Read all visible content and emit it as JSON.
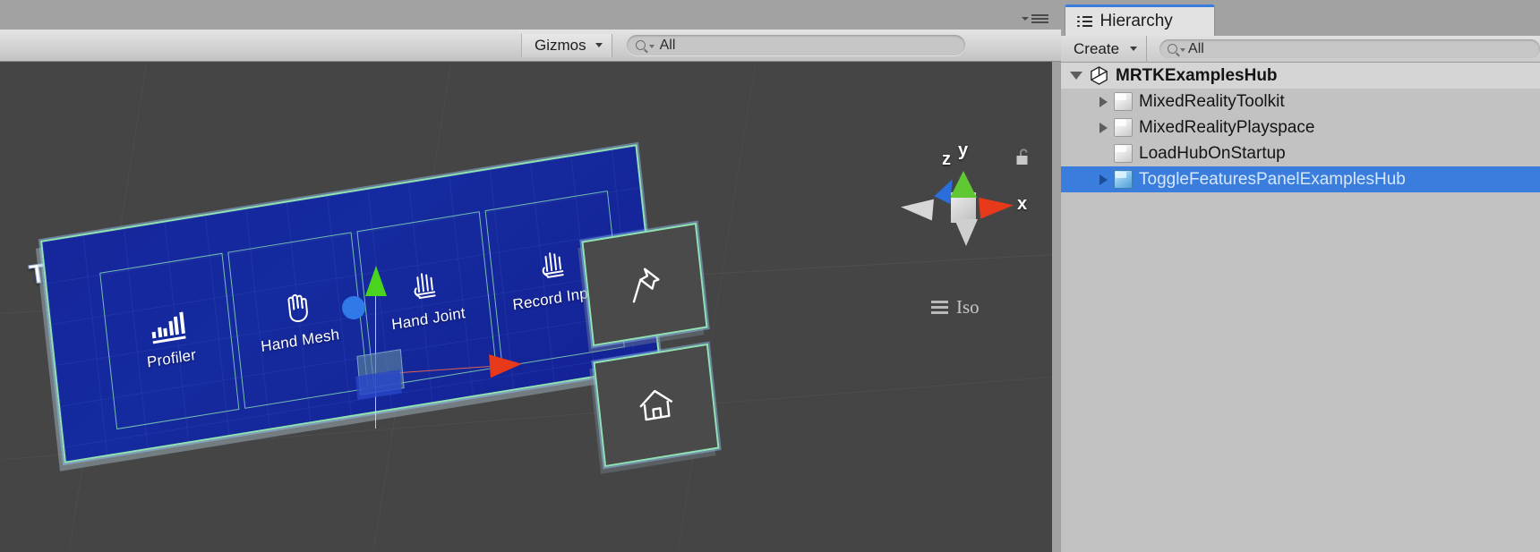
{
  "scene_toolbar": {
    "gizmos_label": "Gizmos",
    "search_placeholder": "All",
    "search_value": "",
    "search_icon": "magnifier-icon",
    "dropdown_icon": "chevron-down-icon"
  },
  "scene_view": {
    "axis_gizmo": {
      "labels": {
        "x": "x",
        "y": "y",
        "z": "z"
      },
      "colors": {
        "x": "#e8391b",
        "y": "#5fc832",
        "z": "#2a6ddb",
        "neutral": "#d7d7d7"
      }
    },
    "projection_label": "Iso",
    "projection_icon": "hamburger-icon",
    "lock_icon": "unlocked-padlock-icon",
    "background_color": "#454545"
  },
  "mrtk_panel": {
    "title": "Toggle Features",
    "panel_color": "#162a9e",
    "selection_outline_color": "#8fe3b4",
    "buttons": [
      {
        "label": "Profiler",
        "icon": "bar-chart-icon"
      },
      {
        "label": "Hand Mesh",
        "icon": "hand-icon"
      },
      {
        "label": "Hand Joint",
        "icon": "hand-joints-icon"
      },
      {
        "label": "Record Input",
        "icon": "hand-joints-icon"
      }
    ],
    "side_buttons": [
      {
        "label": "",
        "icon": "pin-icon"
      },
      {
        "label": "",
        "icon": "home-icon"
      }
    ]
  },
  "hierarchy": {
    "tab_label": "Hierarchy",
    "tab_icon": "list-icon",
    "create_label": "Create",
    "create_icon": "chevron-down-icon",
    "search_placeholder": "All",
    "search_value": "",
    "selection_color": "#3b7ddd",
    "rows": [
      {
        "label": "MRTKExamplesHub",
        "icon": "unity-scene-icon",
        "twisty": "open",
        "depth": 0,
        "selected": false,
        "is_root": true
      },
      {
        "label": "MixedRealityToolkit",
        "icon": "gameobject-cube-icon",
        "twisty": "closed",
        "depth": 1,
        "selected": false,
        "is_root": false
      },
      {
        "label": "MixedRealityPlayspace",
        "icon": "gameobject-cube-icon",
        "twisty": "closed",
        "depth": 1,
        "selected": false,
        "is_root": false
      },
      {
        "label": "LoadHubOnStartup",
        "icon": "gameobject-cube-icon",
        "twisty": "none",
        "depth": 1,
        "selected": false,
        "is_root": false
      },
      {
        "label": "ToggleFeaturesPanelExamplesHub",
        "icon": "prefab-cube-icon",
        "twisty": "closed",
        "depth": 1,
        "selected": true,
        "is_root": false
      }
    ]
  }
}
